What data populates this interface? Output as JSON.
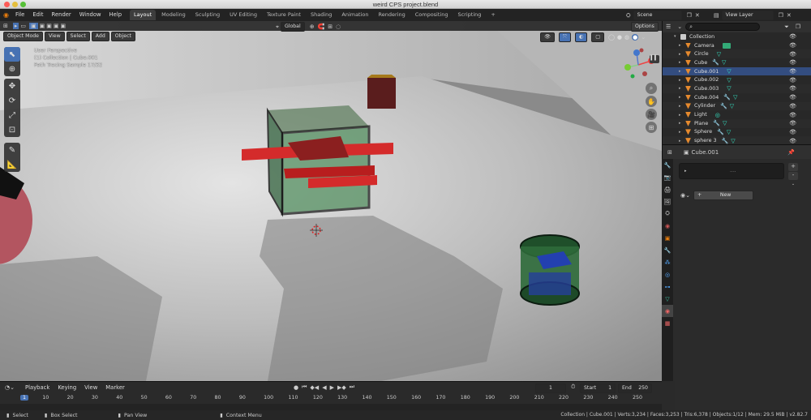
{
  "window": {
    "title": "weird CPS project.blend"
  },
  "menus": [
    "File",
    "Edit",
    "Render",
    "Window",
    "Help"
  ],
  "workspaces": [
    {
      "label": "Layout",
      "active": true
    },
    {
      "label": "Modeling"
    },
    {
      "label": "Sculpting"
    },
    {
      "label": "UV Editing"
    },
    {
      "label": "Texture Paint"
    },
    {
      "label": "Shading"
    },
    {
      "label": "Animation"
    },
    {
      "label": "Rendering"
    },
    {
      "label": "Compositing"
    },
    {
      "label": "Scripting"
    }
  ],
  "add_workspace": "+",
  "scene": {
    "label": "Scene"
  },
  "view_layer": {
    "label": "View Layer"
  },
  "viewport": {
    "mode": "Object Mode",
    "menus": [
      "View",
      "Select",
      "Add",
      "Object"
    ],
    "orientation": "Global",
    "options": "Options",
    "overlay": {
      "line1": "User Perspective",
      "line2": "(1) Collection | Cube.001",
      "line3": "Path Tracing Sample 17/32"
    }
  },
  "outliner": {
    "search_placeholder": "",
    "collection": "Collection",
    "items": [
      {
        "name": "Camera",
        "color": "#e68a2e",
        "extra": "cam"
      },
      {
        "name": "Circle",
        "color": "#e68a2e",
        "extra": "mat"
      },
      {
        "name": "Cube",
        "color": "#e68a2e",
        "extra": "modmat"
      },
      {
        "name": "Cube.001",
        "color": "#e68a2e",
        "extra": "mat",
        "selected": true
      },
      {
        "name": "Cube.002",
        "color": "#e68a2e",
        "extra": "mat"
      },
      {
        "name": "Cube.003",
        "color": "#e68a2e",
        "extra": "mat"
      },
      {
        "name": "Cube.004",
        "color": "#e68a2e",
        "extra": "modmat"
      },
      {
        "name": "Cylinder",
        "color": "#e68a2e",
        "extra": "modmat"
      },
      {
        "name": "Light",
        "color": "#e68a2e",
        "extra": "light"
      },
      {
        "name": "Plane",
        "color": "#e68a2e",
        "extra": "modmat"
      },
      {
        "name": "Sphere",
        "color": "#e68a2e",
        "extra": "modmat"
      },
      {
        "name": "sphere 3",
        "color": "#e68a2e",
        "extra": "modmat"
      }
    ]
  },
  "properties": {
    "object_name": "Cube.001",
    "slot_dots": "....",
    "new_button": "New",
    "plus": "+",
    "minus": "-"
  },
  "timeline": {
    "menus": [
      "Playback",
      "Keying",
      "View",
      "Marker"
    ],
    "current_frame": "1",
    "start_label": "Start",
    "start": "1",
    "end_label": "End",
    "end": "250",
    "ticks": [
      "1",
      "10",
      "20",
      "30",
      "40",
      "50",
      "60",
      "70",
      "80",
      "90",
      "100",
      "110",
      "120",
      "130",
      "140",
      "150",
      "160",
      "170",
      "180",
      "190",
      "200",
      "210",
      "220",
      "230",
      "240",
      "250"
    ]
  },
  "statusbar": {
    "select": "Select",
    "box_select": "Box Select",
    "pan_view": "Pan View",
    "context_menu": "Context Menu",
    "info": "Collection | Cube.001 | Verts:3,234 | Faces:3,253 | Tris:6,378 | Objects:1/12 | Mem: 29.5 MiB | v2.82.7"
  },
  "colors": {
    "accent": "#4772b3",
    "selected_row": "#334d80",
    "material_icon": "#3ec7a7"
  }
}
